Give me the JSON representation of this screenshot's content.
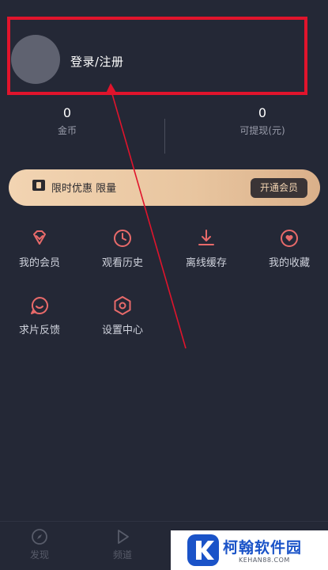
{
  "profile": {
    "login_label": "登录/注册"
  },
  "stats": [
    {
      "value": "0",
      "label": "金币"
    },
    {
      "value": "0",
      "label": "可提现(元)"
    }
  ],
  "vip_banner": {
    "text": "限时优惠 限量",
    "button_label": "开通会员"
  },
  "menu": [
    {
      "label": "我的会员",
      "icon": "diamond-icon"
    },
    {
      "label": "观看历史",
      "icon": "clock-icon"
    },
    {
      "label": "离线缓存",
      "icon": "download-icon"
    },
    {
      "label": "我的收藏",
      "icon": "heart-icon"
    },
    {
      "label": "求片反馈",
      "icon": "feedback-icon"
    },
    {
      "label": "设置中心",
      "icon": "settings-icon"
    }
  ],
  "bottom_nav": [
    {
      "label": "发现",
      "icon": "compass-icon"
    },
    {
      "label": "频道",
      "icon": "play-icon"
    }
  ],
  "watermark": {
    "title": "柯翰软件园",
    "subtitle": "KEHAN88.COM"
  },
  "colors": {
    "background": "#242836",
    "accent_icon": "#e86a6a",
    "highlight_box": "#e0142c",
    "vip_gold": "#f2d4b2",
    "watermark_blue": "#1a53c8"
  }
}
